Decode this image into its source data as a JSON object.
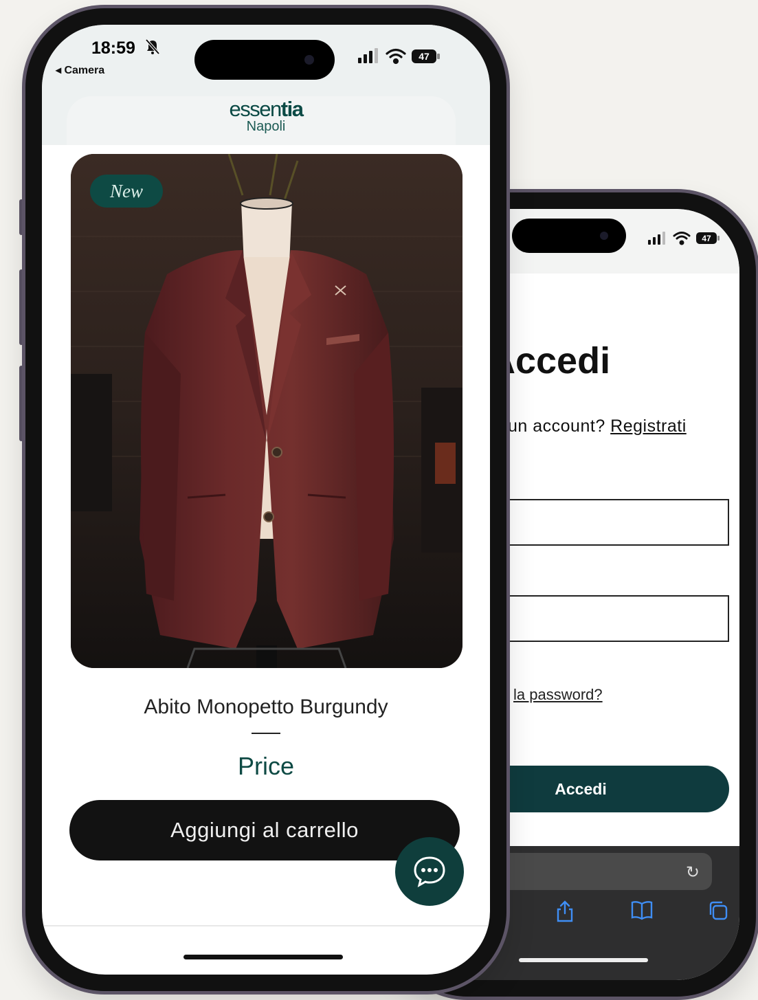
{
  "back_screen": {
    "title": "Accedi",
    "account_prompt": "un account?",
    "register_link": "Registrati",
    "forgot_password": "la password?",
    "submit_label": "Accedi",
    "battery": "47"
  },
  "front_screen": {
    "status": {
      "time": "18:59",
      "back_app": "◂ Camera",
      "battery": "47"
    },
    "logo": {
      "word_light": "essen",
      "word_bold": "tia",
      "city": "Napoli"
    },
    "badge": "New",
    "product_name": "Abito Monopetto Burgundy",
    "price": "Price",
    "add_to_cart": "Aggiungi al carrello"
  },
  "colors": {
    "brand_green": "#0e4a44",
    "button_dark": "#121212",
    "jacket": "#6b2a2a",
    "background": "#f3f2ee"
  },
  "icons": [
    "bell-slash-icon",
    "signal-icon",
    "wifi-icon",
    "battery-icon",
    "chat-icon",
    "reload-icon",
    "share-icon",
    "bookmarks-icon",
    "tabs-icon"
  ]
}
